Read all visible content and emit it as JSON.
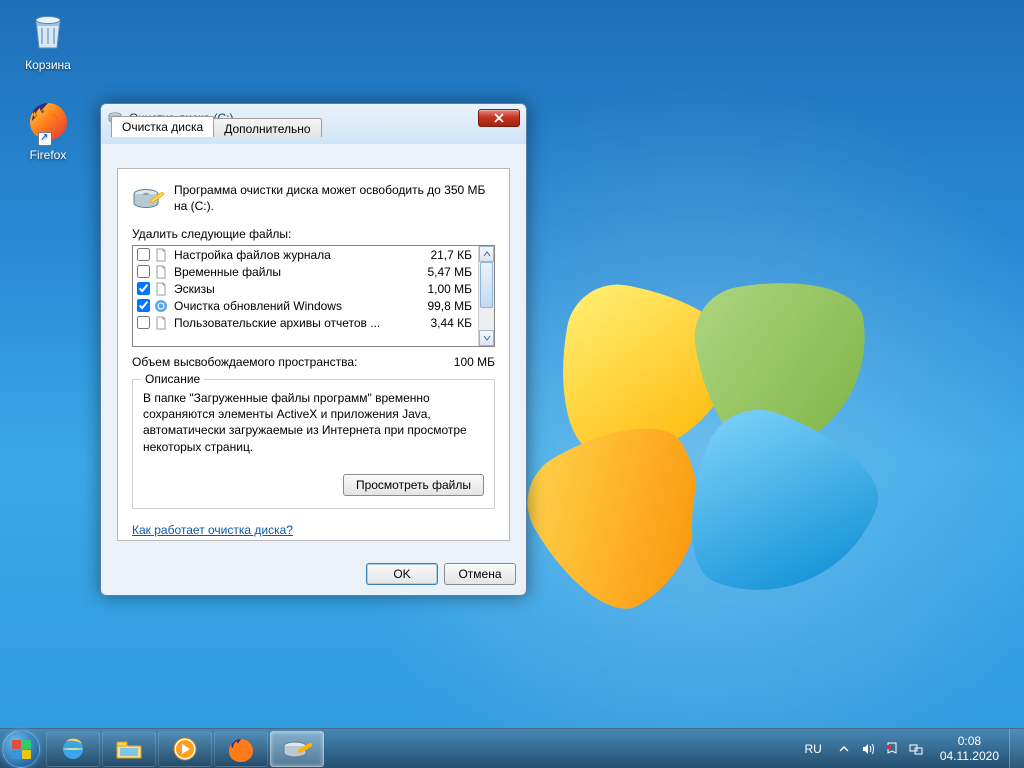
{
  "desktop": {
    "recycle_label": "Корзина",
    "firefox_label": "Firefox"
  },
  "window": {
    "title": "Очистка диска  (C:)",
    "tabs": {
      "main": "Очистка диска",
      "more": "Дополнительно"
    },
    "intro": "Программа очистки диска может освободить до 350 МБ на  (C:).",
    "delete_label": "Удалить следующие файлы:",
    "files": [
      {
        "name": "Настройка файлов журнала",
        "size": "21,7 КБ",
        "checked": false,
        "icon": "file"
      },
      {
        "name": "Временные файлы",
        "size": "5,47 МБ",
        "checked": false,
        "icon": "file"
      },
      {
        "name": "Эскизы",
        "size": "1,00 МБ",
        "checked": true,
        "icon": "file"
      },
      {
        "name": "Очистка обновлений Windows",
        "size": "99,8 МБ",
        "checked": true,
        "icon": "update"
      },
      {
        "name": "Пользовательские архивы отчетов ...",
        "size": "3,44 КБ",
        "checked": false,
        "icon": "file"
      }
    ],
    "freed_label": "Объем высвобождаемого пространства:",
    "freed_value": "100 МБ",
    "desc_legend": "Описание",
    "desc_text": "В папке \"Загруженные файлы программ\" временно сохраняются элементы ActiveX и приложения Java, автоматически загружаемые из Интернета при просмотре некоторых страниц.",
    "view_files_btn": "Просмотреть файлы",
    "help_link": "Как работает очистка диска?",
    "ok_btn": "OK",
    "cancel_btn": "Отмена"
  },
  "taskbar": {
    "lang": "RU",
    "time": "0:08",
    "date": "04.11.2020"
  }
}
